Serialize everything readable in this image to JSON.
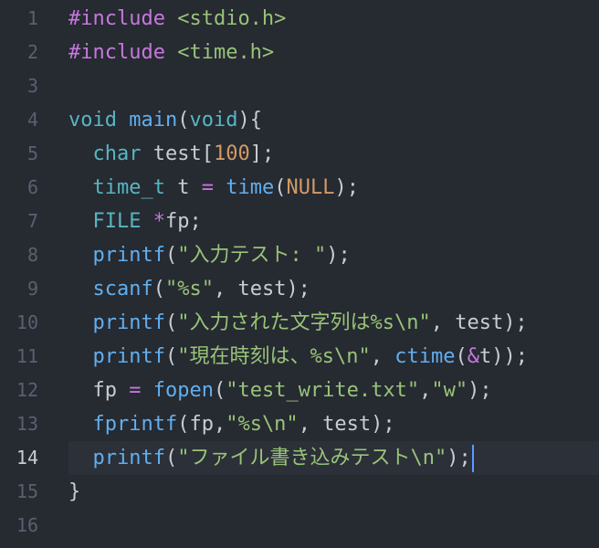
{
  "colors": {
    "background": "#262a31",
    "current_line": "#2c3038",
    "gutter_text": "#5a6070",
    "plain": "#c8ccd4",
    "keyword": "#c678dd",
    "type": "#56b6c2",
    "function": "#61afef",
    "string": "#98c379",
    "number": "#d19a66",
    "constant": "#d19a66",
    "cursor": "#5a9bff"
  },
  "current_line": 14,
  "lines": [
    {
      "number": "1",
      "tokens": [
        {
          "t": "#include",
          "c": "keyword"
        },
        {
          "t": " <stdio.h>",
          "c": "string"
        }
      ]
    },
    {
      "number": "2",
      "tokens": [
        {
          "t": "#include",
          "c": "keyword"
        },
        {
          "t": " <time.h>",
          "c": "string"
        }
      ]
    },
    {
      "number": "3",
      "tokens": []
    },
    {
      "number": "4",
      "tokens": [
        {
          "t": "void",
          "c": "type"
        },
        {
          "t": " ",
          "c": "plain"
        },
        {
          "t": "main",
          "c": "function"
        },
        {
          "t": "(",
          "c": "plain"
        },
        {
          "t": "void",
          "c": "type"
        },
        {
          "t": "){",
          "c": "plain"
        }
      ]
    },
    {
      "number": "5",
      "tokens": [
        {
          "t": "  ",
          "c": "plain"
        },
        {
          "t": "char",
          "c": "type"
        },
        {
          "t": " test[",
          "c": "plain"
        },
        {
          "t": "100",
          "c": "number"
        },
        {
          "t": "];",
          "c": "plain"
        }
      ]
    },
    {
      "number": "6",
      "tokens": [
        {
          "t": "  ",
          "c": "plain"
        },
        {
          "t": "time_t",
          "c": "type"
        },
        {
          "t": " t ",
          "c": "plain"
        },
        {
          "t": "=",
          "c": "keyword"
        },
        {
          "t": " ",
          "c": "plain"
        },
        {
          "t": "time",
          "c": "function"
        },
        {
          "t": "(",
          "c": "plain"
        },
        {
          "t": "NULL",
          "c": "constant"
        },
        {
          "t": ");",
          "c": "plain"
        }
      ]
    },
    {
      "number": "7",
      "tokens": [
        {
          "t": "  ",
          "c": "plain"
        },
        {
          "t": "FILE",
          "c": "type"
        },
        {
          "t": " ",
          "c": "plain"
        },
        {
          "t": "*",
          "c": "keyword"
        },
        {
          "t": "fp;",
          "c": "plain"
        }
      ]
    },
    {
      "number": "8",
      "tokens": [
        {
          "t": "  ",
          "c": "plain"
        },
        {
          "t": "printf",
          "c": "function"
        },
        {
          "t": "(",
          "c": "plain"
        },
        {
          "t": "\"入力テスト: \"",
          "c": "string"
        },
        {
          "t": ");",
          "c": "plain"
        }
      ]
    },
    {
      "number": "9",
      "tokens": [
        {
          "t": "  ",
          "c": "plain"
        },
        {
          "t": "scanf",
          "c": "function"
        },
        {
          "t": "(",
          "c": "plain"
        },
        {
          "t": "\"%s\"",
          "c": "string"
        },
        {
          "t": ", test);",
          "c": "plain"
        }
      ]
    },
    {
      "number": "10",
      "tokens": [
        {
          "t": "  ",
          "c": "plain"
        },
        {
          "t": "printf",
          "c": "function"
        },
        {
          "t": "(",
          "c": "plain"
        },
        {
          "t": "\"入力された文字列は%s\\n\"",
          "c": "string"
        },
        {
          "t": ", test);",
          "c": "plain"
        }
      ]
    },
    {
      "number": "11",
      "tokens": [
        {
          "t": "  ",
          "c": "plain"
        },
        {
          "t": "printf",
          "c": "function"
        },
        {
          "t": "(",
          "c": "plain"
        },
        {
          "t": "\"現在時刻は、%s\\n\"",
          "c": "string"
        },
        {
          "t": ", ",
          "c": "plain"
        },
        {
          "t": "ctime",
          "c": "function"
        },
        {
          "t": "(",
          "c": "plain"
        },
        {
          "t": "&",
          "c": "keyword"
        },
        {
          "t": "t));",
          "c": "plain"
        }
      ]
    },
    {
      "number": "12",
      "tokens": [
        {
          "t": "  fp ",
          "c": "plain"
        },
        {
          "t": "=",
          "c": "keyword"
        },
        {
          "t": " ",
          "c": "plain"
        },
        {
          "t": "fopen",
          "c": "function"
        },
        {
          "t": "(",
          "c": "plain"
        },
        {
          "t": "\"test_write.txt\"",
          "c": "string"
        },
        {
          "t": ",",
          "c": "plain"
        },
        {
          "t": "\"w\"",
          "c": "string"
        },
        {
          "t": ");",
          "c": "plain"
        }
      ]
    },
    {
      "number": "13",
      "tokens": [
        {
          "t": "  ",
          "c": "plain"
        },
        {
          "t": "fprintf",
          "c": "function"
        },
        {
          "t": "(fp,",
          "c": "plain"
        },
        {
          "t": "\"%s\\n\"",
          "c": "string"
        },
        {
          "t": ", test);",
          "c": "plain"
        }
      ]
    },
    {
      "number": "14",
      "tokens": [
        {
          "t": "  ",
          "c": "plain"
        },
        {
          "t": "printf",
          "c": "function"
        },
        {
          "t": "(",
          "c": "plain"
        },
        {
          "t": "\"ファイル書き込みテスト\\n\"",
          "c": "string"
        },
        {
          "t": ");",
          "c": "plain"
        }
      ]
    },
    {
      "number": "15",
      "tokens": [
        {
          "t": "}",
          "c": "plain"
        }
      ]
    },
    {
      "number": "16",
      "tokens": []
    }
  ]
}
